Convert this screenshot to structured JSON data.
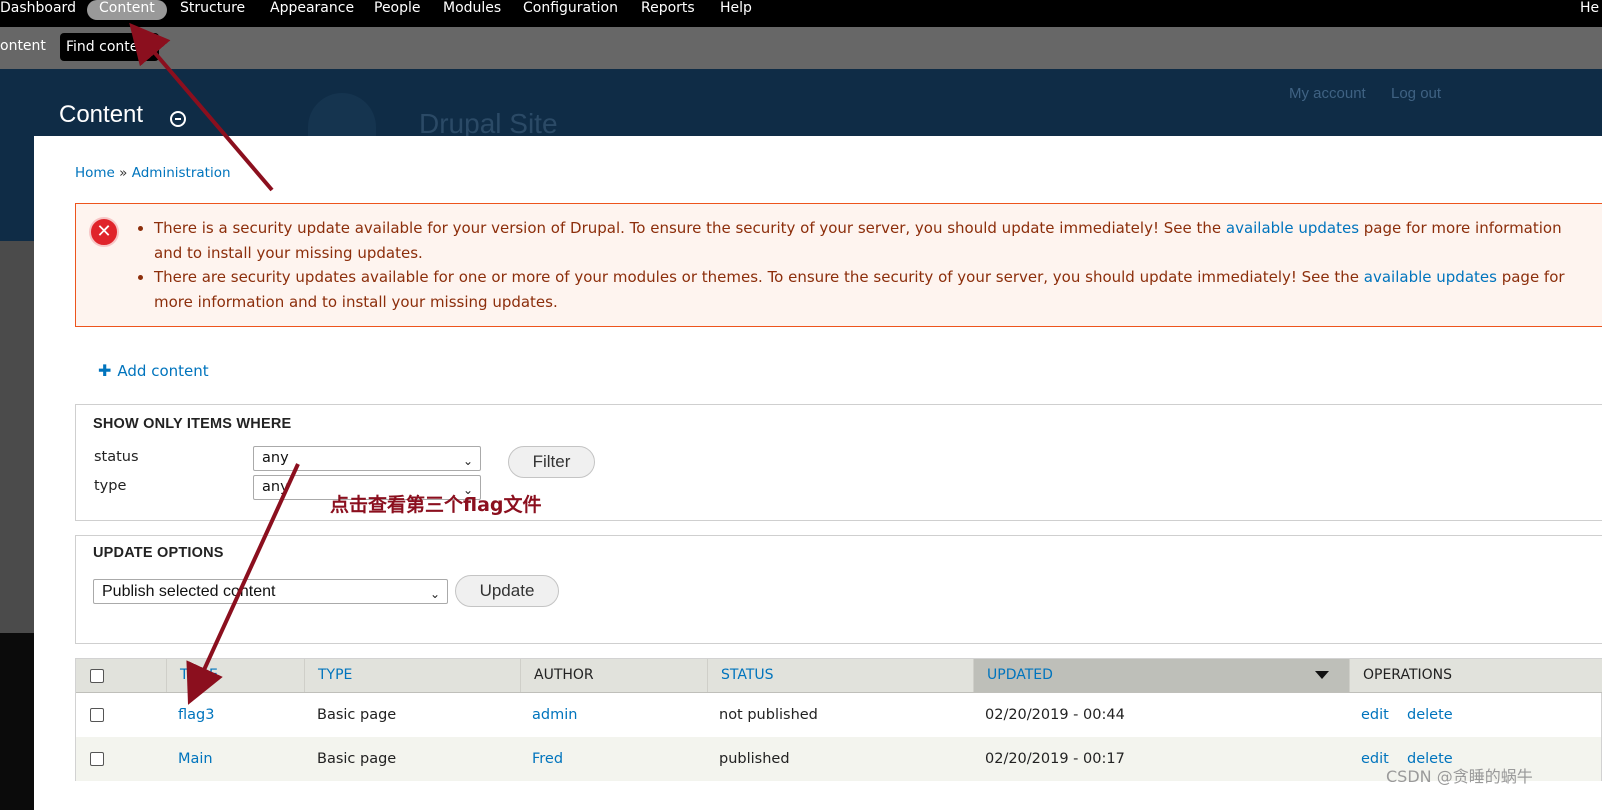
{
  "toolbar": {
    "items": [
      "Dashboard",
      "Content",
      "Structure",
      "Appearance",
      "People",
      "Modules",
      "Configuration",
      "Reports",
      "Help"
    ],
    "right_label": "He"
  },
  "shortcuts": {
    "left_label": "ontent",
    "find_content": "Find content"
  },
  "header": {
    "page_title": "Content",
    "site_name": "Drupal Site",
    "my_account": "My account",
    "log_out": "Log out"
  },
  "breadcrumb": {
    "home": "Home",
    "separator": "»",
    "admin": "Administration"
  },
  "messages": {
    "items": [
      {
        "before": "There is a security update available for your version of Drupal. To ensure the security of your server, you should update immediately! See the ",
        "link": "available updates",
        "after": " page for more information and to install your missing updates."
      },
      {
        "before": "There are security updates available for one or more of your modules or themes. To ensure the security of your server, you should update immediately! See the ",
        "link": "available updates",
        "after": " page for more information and to install your missing updates."
      }
    ]
  },
  "add_content": "Add content",
  "filters": {
    "legend": "SHOW ONLY ITEMS WHERE",
    "status_label": "status",
    "status_value": "any",
    "type_label": "type",
    "type_value": "any",
    "filter_button": "Filter"
  },
  "update_options": {
    "legend": "UPDATE OPTIONS",
    "action_value": "Publish selected content",
    "update_button": "Update"
  },
  "table": {
    "headers": {
      "title": "TITLE",
      "type": "TYPE",
      "author": "AUTHOR",
      "status": "STATUS",
      "updated": "UPDATED",
      "operations": "OPERATIONS"
    },
    "rows": [
      {
        "title": "flag3",
        "type": "Basic page",
        "author": "admin",
        "status": "not published",
        "updated": "02/20/2019 - 00:44",
        "edit": "edit",
        "delete": "delete"
      },
      {
        "title": "Main",
        "type": "Basic page",
        "author": "Fred",
        "status": "published",
        "updated": "02/20/2019 - 00:17",
        "edit": "edit",
        "delete": "delete"
      }
    ]
  },
  "annotation": {
    "text": "点击查看第三个flag文件",
    "color": "#8b0f1e"
  },
  "watermark": "CSDN @贪睡的蜗牛",
  "colors": {
    "link": "#0074bd",
    "header_bg": "#0f2c46",
    "error_border": "#ed541d",
    "error_bg": "#fef4ef"
  }
}
